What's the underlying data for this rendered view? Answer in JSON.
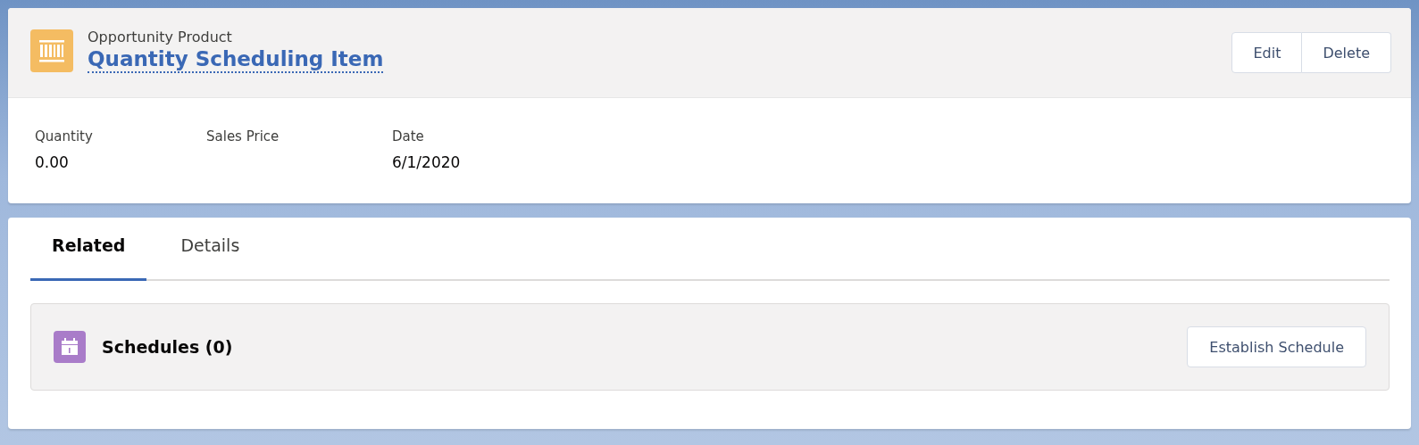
{
  "record": {
    "object_type": "Opportunity Product",
    "title": "Quantity Scheduling Item",
    "actions": [
      "Edit",
      "Delete"
    ]
  },
  "fields": [
    {
      "label": "Quantity",
      "value": "0.00"
    },
    {
      "label": "Sales Price"
    },
    {
      "label": "Date",
      "value": "6/1/2020"
    }
  ],
  "tabs": [
    {
      "label": "Related",
      "selected": true
    },
    {
      "label": "Details",
      "selected": false
    }
  ],
  "related_list": {
    "title": "Schedules (0)",
    "action": "Establish Schedule"
  }
}
